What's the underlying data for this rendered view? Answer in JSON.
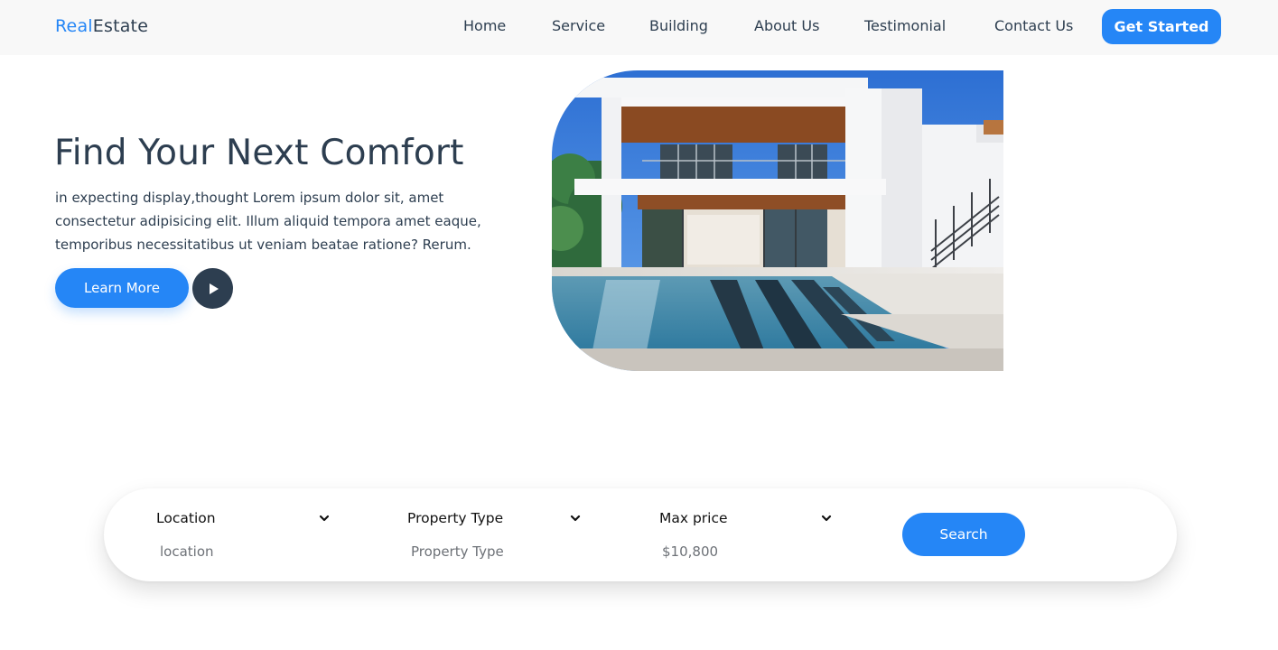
{
  "brand": {
    "part1": "Real",
    "part2": "Estate"
  },
  "nav": {
    "links": [
      "Home",
      "Service",
      "Building",
      "About Us",
      "Testimonial",
      "Contact Us"
    ],
    "cta": "Get Started"
  },
  "hero": {
    "title": "Find Your Next Comfort",
    "lines": [
      "in expecting display,thought Lorem ipsum dolor sit, amet",
      "consectetur adipisicing elit. Illum aliquid tempora amet eaque,",
      "temporibus necessitatibus ut veniam beatae ratione? Rerum."
    ],
    "learn_more": "Learn More",
    "play_icon": "play-icon"
  },
  "search": {
    "location": {
      "label": "Location",
      "value": "location"
    },
    "property_type": {
      "label": "Property Type",
      "value": "Property Type"
    },
    "max_price": {
      "label": "Max price",
      "value": "$10,800"
    },
    "button": "Search"
  },
  "colors": {
    "accent": "#2586f6",
    "dark": "#2d3e50",
    "nav_bg": "#f8f8f8"
  }
}
